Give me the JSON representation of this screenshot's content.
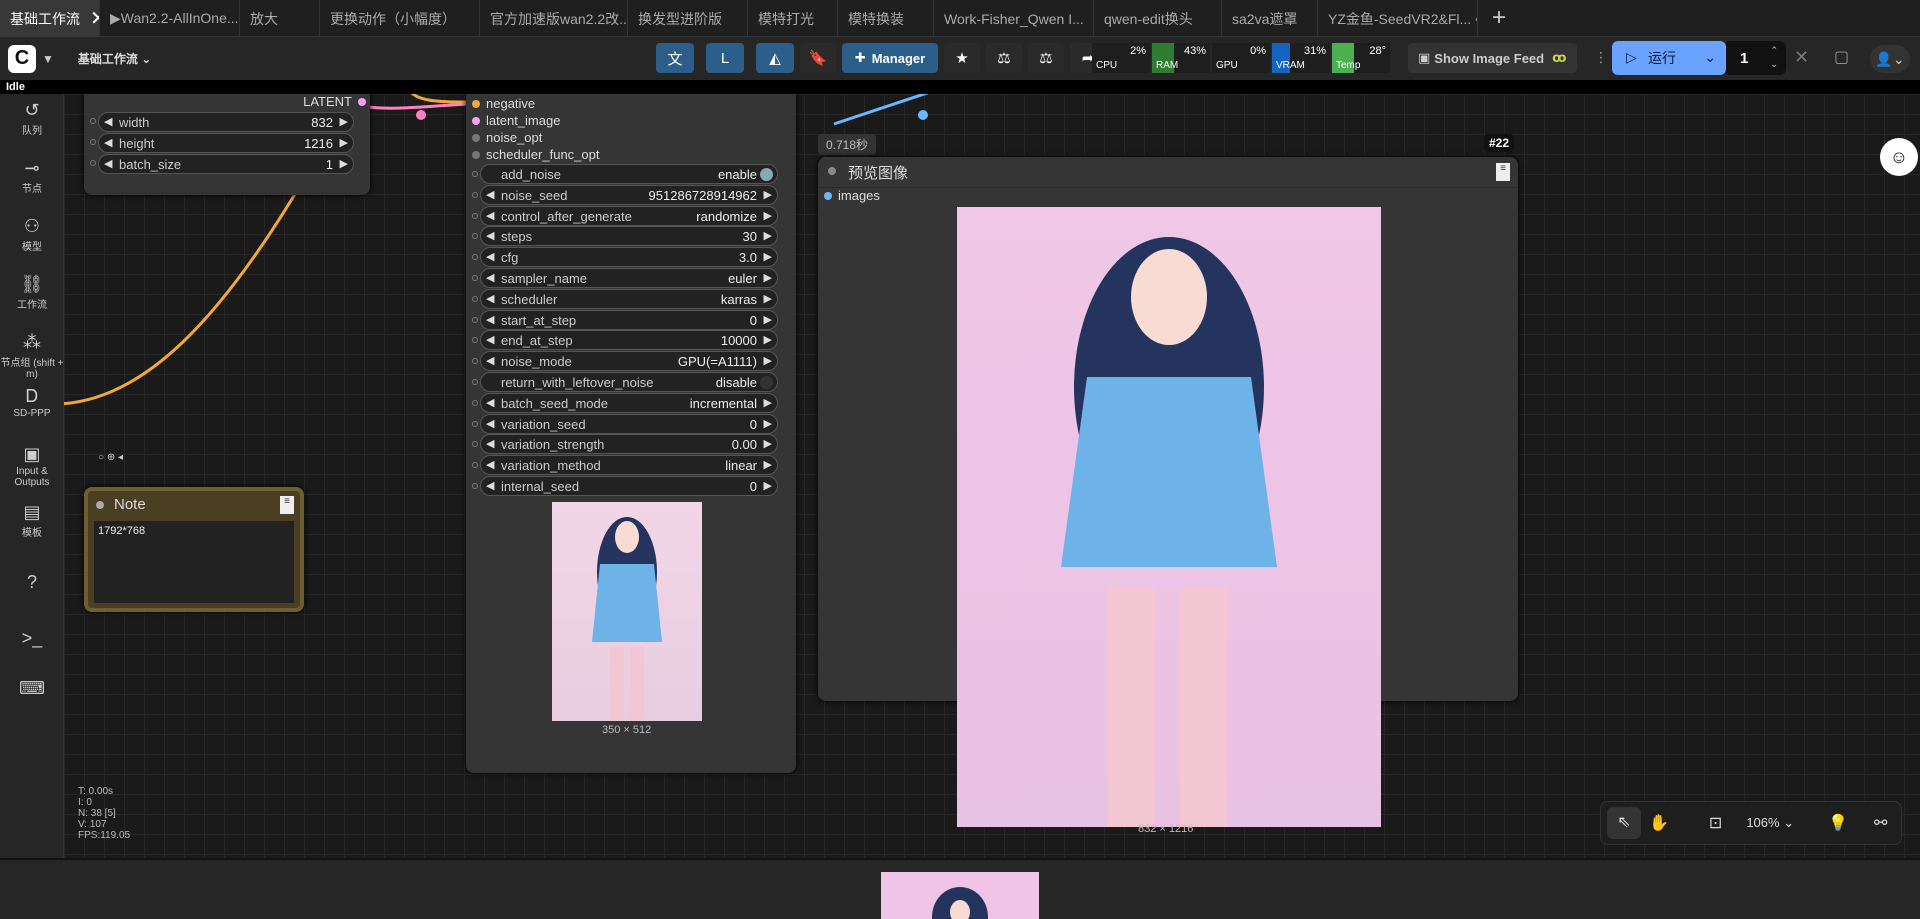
{
  "tabs": [
    {
      "label": "基础工作流",
      "active": true
    },
    {
      "label": "▶Wan2.2-AllInOne...",
      "active": false
    },
    {
      "label": "放大",
      "active": false
    },
    {
      "label": "更换动作（小幅度）",
      "active": false
    },
    {
      "label": "官方加速版wan2.2改...",
      "active": false
    },
    {
      "label": "换发型进阶版",
      "active": false
    },
    {
      "label": "模特打光",
      "active": false
    },
    {
      "label": "模特换装",
      "active": false
    },
    {
      "label": "Work-Fisher_Qwen I...",
      "active": false
    },
    {
      "label": "qwen-edit换头",
      "active": false
    },
    {
      "label": "sa2va遮罩",
      "active": false
    },
    {
      "label": "YZ金鱼-SeedVR2&Fl...",
      "active": false
    }
  ],
  "topbar": {
    "workflow_menu": "基础工作流",
    "manager_label": "Manager",
    "monitors": [
      {
        "label": "CPU",
        "value": "2%",
        "fill_percent": 2,
        "color": "#2e7d32"
      },
      {
        "label": "RAM",
        "value": "43%",
        "fill_percent": 43,
        "color": "#2e7d32"
      },
      {
        "label": "GPU",
        "value": "0%",
        "fill_percent": 0,
        "color": "#2e7d32"
      },
      {
        "label": "VRAM",
        "value": "31%",
        "fill_percent": 31,
        "color": "#1565c0"
      },
      {
        "label": "Temp",
        "value": "28°",
        "fill_percent": 28,
        "color": "#4caf50"
      }
    ],
    "feed_label": "Show Image Feed",
    "run_label": "运行",
    "queue_count": "1"
  },
  "status": "Idle",
  "sidebar": [
    {
      "icon": "history-icon",
      "label": "队列"
    },
    {
      "icon": "node-icon",
      "label": "节点"
    },
    {
      "icon": "model-icon",
      "label": "模型"
    },
    {
      "icon": "workflow-icon",
      "label": "工作流"
    },
    {
      "icon": "node-group-icon",
      "label": "节点组 (shift + m)"
    },
    {
      "icon": "sd-ppp-icon",
      "label": "SD-PPP"
    },
    {
      "icon": "image-icon",
      "label": "Input & Outputs"
    },
    {
      "icon": "template-icon",
      "label": "模板"
    },
    {
      "icon": "help-icon",
      "label": ""
    },
    {
      "icon": "terminal-icon",
      "label": ""
    },
    {
      "icon": "keyboard-icon",
      "label": ""
    }
  ],
  "latent_node": {
    "output": "LATENT",
    "widgets": [
      {
        "name": "width",
        "value": "832"
      },
      {
        "name": "height",
        "value": "1216"
      },
      {
        "name": "batch_size",
        "value": "1"
      }
    ]
  },
  "note": {
    "title": "Note",
    "text": "1792*768"
  },
  "sampler_node": {
    "inputs": [
      "negative",
      "latent_image",
      "noise_opt",
      "scheduler_func_opt"
    ],
    "widgets": [
      {
        "name": "add_noise",
        "value": "enable",
        "kind": "toggle"
      },
      {
        "name": "noise_seed",
        "value": "951286728914962",
        "kind": "number"
      },
      {
        "name": "control_after_generate",
        "value": "randomize",
        "kind": "combo"
      },
      {
        "name": "steps",
        "value": "30",
        "kind": "number"
      },
      {
        "name": "cfg",
        "value": "3.0",
        "kind": "number"
      },
      {
        "name": "sampler_name",
        "value": "euler",
        "kind": "combo"
      },
      {
        "name": "scheduler",
        "value": "karras",
        "kind": "combo"
      },
      {
        "name": "start_at_step",
        "value": "0",
        "kind": "number"
      },
      {
        "name": "end_at_step",
        "value": "10000",
        "kind": "number"
      },
      {
        "name": "noise_mode",
        "value": "GPU(=A1111)",
        "kind": "combo"
      },
      {
        "name": "return_with_leftover_noise",
        "value": "disable",
        "kind": "toggle"
      },
      {
        "name": "batch_seed_mode",
        "value": "incremental",
        "kind": "combo"
      },
      {
        "name": "variation_seed",
        "value": "0",
        "kind": "number"
      },
      {
        "name": "variation_strength",
        "value": "0.00",
        "kind": "number"
      },
      {
        "name": "variation_method",
        "value": "linear",
        "kind": "combo"
      },
      {
        "name": "internal_seed",
        "value": "0",
        "kind": "number"
      }
    ],
    "preview_size": "350 × 512"
  },
  "preview_node": {
    "timing": "0.718秒",
    "id": "#22",
    "title": "预览图像",
    "input": "images",
    "image_size": "832 × 1216"
  },
  "stats": [
    "T: 0.00s",
    "I: 0",
    "N: 38 [5]",
    "V: 107",
    "FPS:119.05"
  ],
  "zoom": "106%"
}
